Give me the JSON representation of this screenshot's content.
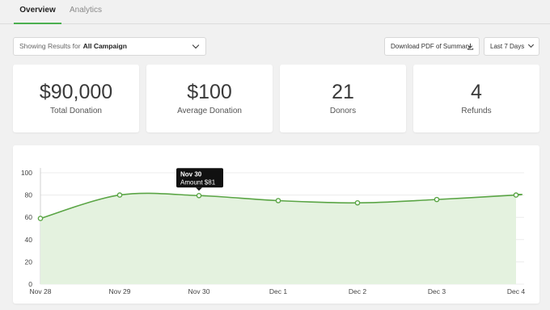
{
  "tabs": [
    {
      "label": "Overview",
      "active": true
    },
    {
      "label": "Analytics",
      "active": false
    }
  ],
  "filter": {
    "prefix": "Showing Results for",
    "value": "All Campaign"
  },
  "actions": {
    "pdf_label": "Download PDF of Summary",
    "range_label": "Last 7 Days"
  },
  "stats": [
    {
      "value": "$90,000",
      "label": "Total Donation"
    },
    {
      "value": "$100",
      "label": "Average Donation"
    },
    {
      "value": "21",
      "label": "Donors"
    },
    {
      "value": "4",
      "label": "Refunds"
    }
  ],
  "colors": {
    "accent": "#4caf50",
    "line": "#5aa545",
    "fill": "#e4f2df"
  },
  "chart_data": {
    "type": "area",
    "categories": [
      "Nov 28",
      "Nov 29",
      "Nov 30",
      "Dec 1",
      "Dec 2",
      "Dec 3",
      "Dec 4"
    ],
    "values": [
      59,
      80,
      79.5,
      75,
      73,
      76,
      80
    ],
    "ylim": [
      0,
      100
    ],
    "yticks": [
      "0",
      "20",
      "40",
      "60",
      "80",
      "100"
    ],
    "tooltip": {
      "title": "Nov 30",
      "text": "Amount $81"
    },
    "grid": true
  }
}
